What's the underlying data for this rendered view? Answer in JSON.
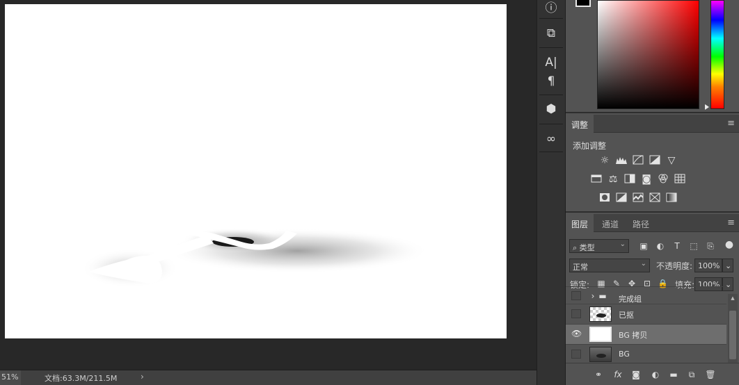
{
  "status": {
    "zoom": "51%",
    "doc_info": "文档:63.3M/211.5M",
    "arrow": "›"
  },
  "icons": {
    "strip": [
      "info-icon",
      "history-brush-icon",
      "character-icon",
      "paragraph-icon",
      "3d-cube-icon",
      "creative-cloud-icon"
    ],
    "adjustments": [
      [
        "brightness-icon",
        "levels-icon",
        "curves-icon",
        "exposure-icon",
        "vibrance-icon"
      ],
      [
        "hue-saturation-icon",
        "color-balance-icon",
        "black-white-icon",
        "photo-filter-icon",
        "channel-mixer-icon",
        "color-lookup-icon"
      ],
      [
        "invert-icon",
        "posterize-icon",
        "threshold-icon",
        "selective-color-icon",
        "gradient-map-icon"
      ]
    ]
  },
  "adjust_panel": {
    "tab": "调整",
    "title": "添加调整"
  },
  "layers_panel": {
    "tabs": [
      "图层",
      "通道",
      "路径"
    ],
    "filter_kind": "类型",
    "blend_mode": "正常",
    "opacity_label": "不透明度:",
    "opacity_value": "100%",
    "lock_label": "锁定:",
    "fill_label": "填充:",
    "fill_value": "100%",
    "layers": [
      {
        "name": "完成组",
        "visible": false
      },
      {
        "name": "已抠",
        "visible": false
      },
      {
        "name": "BG 拷贝",
        "visible": true
      },
      {
        "name": "BG",
        "visible": false
      }
    ]
  },
  "colors": {
    "foreground": "#000000",
    "panel_bg": "#535353",
    "selected_row": "#6e6e6e"
  },
  "glyphs": {
    "info": "ⓘ",
    "history": "⧉",
    "character": "A|",
    "paragraph": "¶",
    "cube": "⬢",
    "cc": "∞",
    "menu": "≡",
    "eye": "👁",
    "search": "⌕",
    "dropdown": "⌄"
  }
}
